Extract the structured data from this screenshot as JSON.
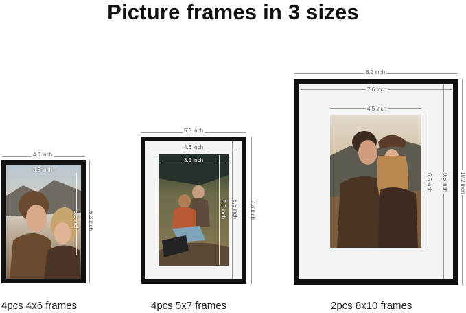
{
  "title": "Picture frames in 3 sizes",
  "frames": [
    {
      "caption": "4pcs 4x6 frames",
      "outer_width": "4.3 inch",
      "outer_height": "6.3 inch",
      "inner_width": "3.6 inch",
      "inner_height": "5.6 inch"
    },
    {
      "caption": "4pcs 5x7 frames",
      "outer_width": "5.3 inch",
      "outer_height": "7.3 inch",
      "mat_width": "4.6 inch",
      "mat_height": "6.6 inch",
      "photo_width": "3.5 inch",
      "photo_height": "5.5 inch"
    },
    {
      "caption": "2pcs 8x10 frames",
      "outer_width": "8.2 inch",
      "outer_height": "10.2 inch",
      "mat_width": "7.6 inch",
      "mat_height": "9.6 inch",
      "photo_width": "4.5 inch",
      "photo_height": "6.5 inch"
    }
  ],
  "colors": {
    "frame": "#111111",
    "mat": "#f4f4f4",
    "dimension_line": "#9a9a9a"
  }
}
